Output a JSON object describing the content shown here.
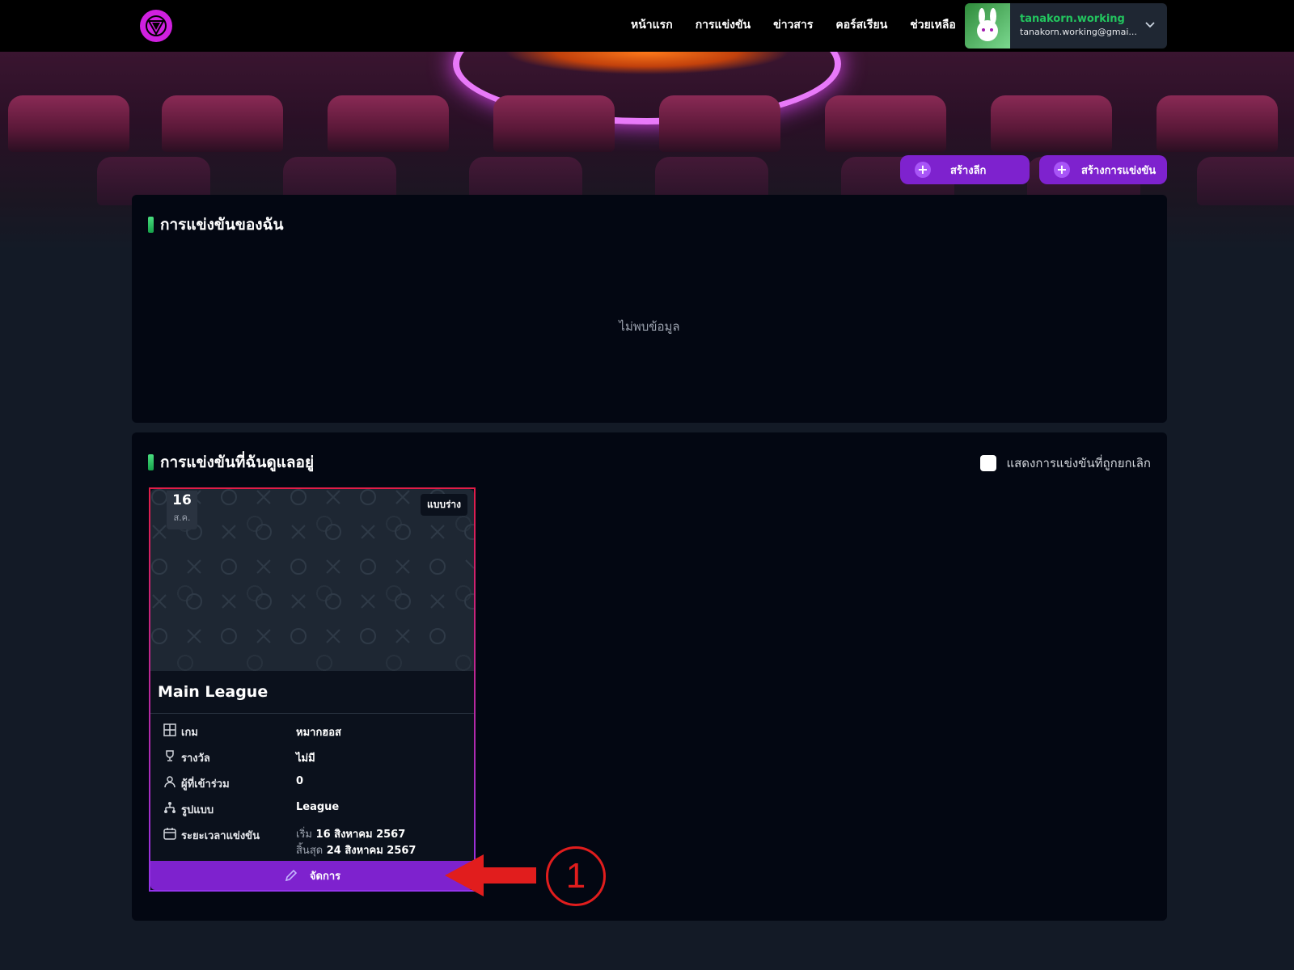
{
  "nav": {
    "links": [
      "หน้าแรก",
      "การแข่งขัน",
      "ข่าวสาร",
      "คอร์สเรียน",
      "ช่วยเหลือ"
    ],
    "user_name": "tanakorn.working",
    "user_email": "tanakorn.working@gmai..."
  },
  "actions": {
    "create_league": "สร้างลีก",
    "create_tournament": "สร้างการแข่งขัน"
  },
  "my_tournaments": {
    "title": "การแข่งขันของฉัน",
    "empty_text": "ไม่พบข้อมูล"
  },
  "managed_tournaments": {
    "title": "การแข่งขันที่ฉันดูแลอยู่",
    "show_cancelled_label": "แสดงการแข่งขันที่ถูกยกเลิก",
    "card": {
      "day": "16",
      "month": "ส.ค.",
      "status": "แบบร่าง",
      "title": "Main League",
      "rows": {
        "game": {
          "label": "เกม",
          "value": "หมากฮอส"
        },
        "prize": {
          "label": "รางวัล",
          "value": "ไม่มี"
        },
        "participants": {
          "label": "ผู้ที่เข้าร่วม",
          "value": "0"
        },
        "format": {
          "label": "รูปแบบ",
          "value": "League"
        },
        "period": {
          "label": "ระยะเวลาแข่งขัน",
          "start_label": "เริ่ม",
          "start_value": "16 สิงหาคม 2567",
          "end_label": "สิ้นสุด",
          "end_value": "24 สิงหาคม 2567"
        }
      },
      "manage_label": "จัดการ"
    }
  },
  "annotation": {
    "number": "1"
  },
  "colors": {
    "accent_purple": "#7e22ce",
    "user_green": "#22c55e",
    "annotation_red": "#e11d1d"
  }
}
